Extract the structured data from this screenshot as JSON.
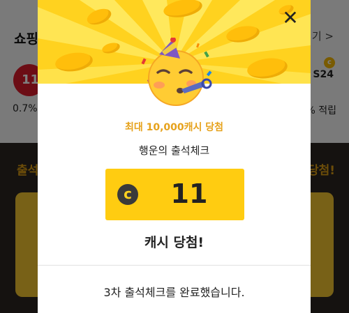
{
  "background": {
    "section_title": "쇼핑",
    "more_link": "기 >",
    "left_badge": "11",
    "left_rate": "0.7%",
    "right_brand": "S24",
    "right_coin": "c",
    "right_rate": "% 적립",
    "dark_left_label": "출석",
    "dark_right_label": "당첨!"
  },
  "modal": {
    "close_label": "✕",
    "subtitle": "최대 10,000캐시 당첨",
    "event_name": "행운의 출석체크",
    "cash_icon": "c",
    "amount": "11",
    "result": "캐시 당첨!",
    "footer_message": "3차 출석체크를 완료했습니다.",
    "emoji": "party-face-icon"
  },
  "colors": {
    "hero": "#ffd21f",
    "amount_box": "#ffcc11",
    "subtitle": "#e6a21c",
    "coin": "#ffbe0b"
  }
}
